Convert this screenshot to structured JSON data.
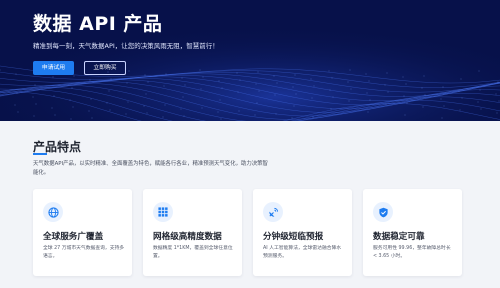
{
  "hero": {
    "title": "数据 API 产品",
    "subtitle": "精准到每一刻，天气数据API，让您的决策风雨无阻，智慧前行！",
    "primary_button": "申请试用",
    "secondary_button": "立即购买"
  },
  "features": {
    "title": "产品特点",
    "description": "天气数据API产品，以实时精准、全面覆盖为特色，赋能各行各业，精准预测天气变化，助力决策智能化。",
    "cards": [
      {
        "icon": "globe-icon",
        "title": "全球服务广覆盖",
        "desc": "全球 27 万城市天气数据查询，支持多语言。"
      },
      {
        "icon": "grid-icon",
        "title": "网格级高精度数据",
        "desc": "数据精度 1*1KM，覆盖到全球任意位置。"
      },
      {
        "icon": "satellite-icon",
        "title": "分钟级短临预报",
        "desc": "AI 人工智能算法，全球雷达融合降水预测服务。"
      },
      {
        "icon": "shield-check-icon",
        "title": "数据稳定可靠",
        "desc": "服务可用性 99.96，整年故障总时长 < 3.65 小时。"
      }
    ]
  },
  "colors": {
    "hero_bg": "#07114a",
    "accent": "#1e7cf0",
    "page_bg": "#f2f4f8"
  }
}
